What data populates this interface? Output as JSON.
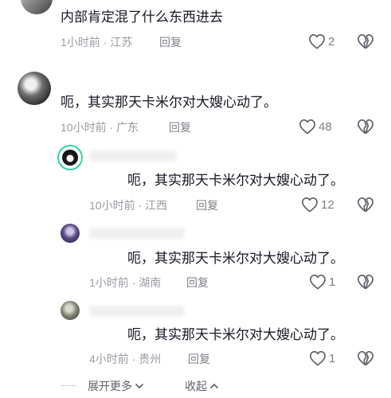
{
  "comments": [
    {
      "text": "内部肯定混了什么东西进去",
      "time_location": "1小时前 · 江苏",
      "reply_label": "回复",
      "likes": "2"
    },
    {
      "text": "呃，其实那天卡米尔对大嫂心动了。",
      "time_location": "10小时前 · 广东",
      "reply_label": "回复",
      "likes": "48"
    }
  ],
  "replies": [
    {
      "text": "呃，其实那天卡米尔对大嫂心动了。",
      "time_location": "10小时前 · 江西",
      "reply_label": "回复",
      "likes": "12"
    },
    {
      "text": "呃，其实那天卡米尔对大嫂心动了。",
      "time_location": "1小时前 · 湖南",
      "reply_label": "回复",
      "likes": "1"
    },
    {
      "text": "呃，其实那天卡米尔对大嫂心动了。",
      "time_location": "4小时前 · 贵州",
      "reply_label": "回复",
      "likes": "1"
    }
  ],
  "footer": {
    "expand_label": "展开更多",
    "collapse_label": "收起"
  },
  "icons": {
    "like": "heart-outline-icon",
    "dislike": "broken-heart-icon",
    "expand": "chevron-down-icon",
    "collapse": "chevron-up-icon"
  }
}
